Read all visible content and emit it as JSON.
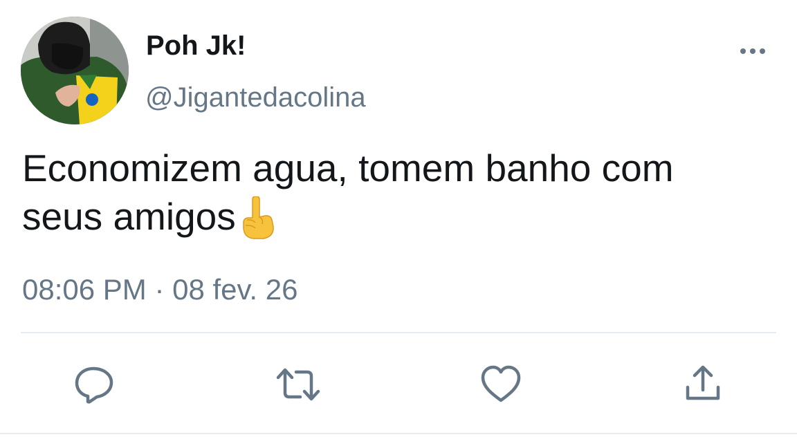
{
  "tweet": {
    "display_name": "Poh Jk!",
    "handle": "@Jigantedacolina",
    "text_line1": "Economizem agua, tomem banho com",
    "text_line2": "seus amigos",
    "emoji": "☝️",
    "time": "08:06 PM",
    "separator": "·",
    "date": "08 fev. 26"
  },
  "icons": {
    "more": "more-options-icon",
    "reply": "reply-icon",
    "retweet": "retweet-icon",
    "like": "like-icon",
    "share": "share-icon"
  },
  "colors": {
    "text": "#14171a",
    "secondary": "#657786",
    "divider": "#e6ecf0"
  }
}
